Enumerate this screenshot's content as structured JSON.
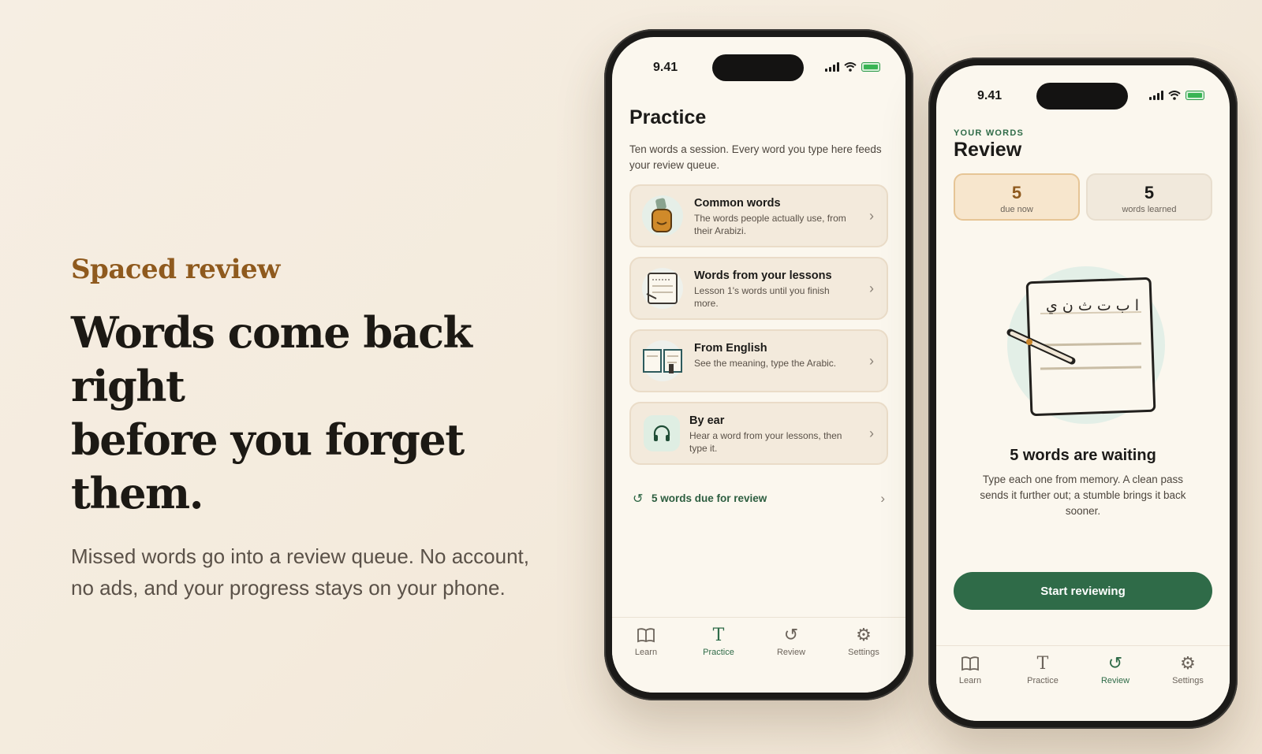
{
  "hero": {
    "eyebrow": "Spaced review",
    "headline_line1": "Words come back right",
    "headline_line2": "before you forget them.",
    "subcopy_line1": "Missed words go into a review queue. No account,",
    "subcopy_line2": "no ads, and your progress stays on your phone."
  },
  "status": {
    "time": "9.41"
  },
  "practice": {
    "title": "Practice",
    "description": "Ten words a session. Every word you type here feeds your review queue.",
    "cards": [
      {
        "title": "Common words",
        "subtitle": "The words people actually use, from their Arabizi.",
        "icon": "jar-icon"
      },
      {
        "title": "Words from your lessons",
        "subtitle": "Lesson 1's words until you finish more.",
        "icon": "notebook-icon"
      },
      {
        "title": "From English",
        "subtitle": "See the meaning, type the Arabic.",
        "icon": "open-book-icon"
      },
      {
        "title": "By ear",
        "subtitle": "Hear a word from your lessons, then type it.",
        "icon": "headphones-icon"
      }
    ],
    "due_link": "5 words due for review"
  },
  "tabs": [
    {
      "label": "Learn",
      "icon": "book-icon"
    },
    {
      "label": "Practice",
      "icon": "type-icon"
    },
    {
      "label": "Review",
      "icon": "history-icon"
    },
    {
      "label": "Settings",
      "icon": "gear-icon"
    }
  ],
  "review": {
    "eyebrow": "YOUR WORDS",
    "title": "Review",
    "stats": [
      {
        "value": "5",
        "label": "due now"
      },
      {
        "value": "5",
        "label": "words learned"
      }
    ],
    "notebook_text": "ا ب ت ث ن ي",
    "heading": "5 words are waiting",
    "body": "Type each one from memory. A clean pass sends it further out; a stumble brings it back sooner.",
    "cta": "Start reviewing"
  },
  "colors": {
    "brand_green": "#2f6b48",
    "accent_brown": "#8f5a1e",
    "card_bg": "#f3eadc",
    "screen_bg": "#fbf7ee"
  }
}
